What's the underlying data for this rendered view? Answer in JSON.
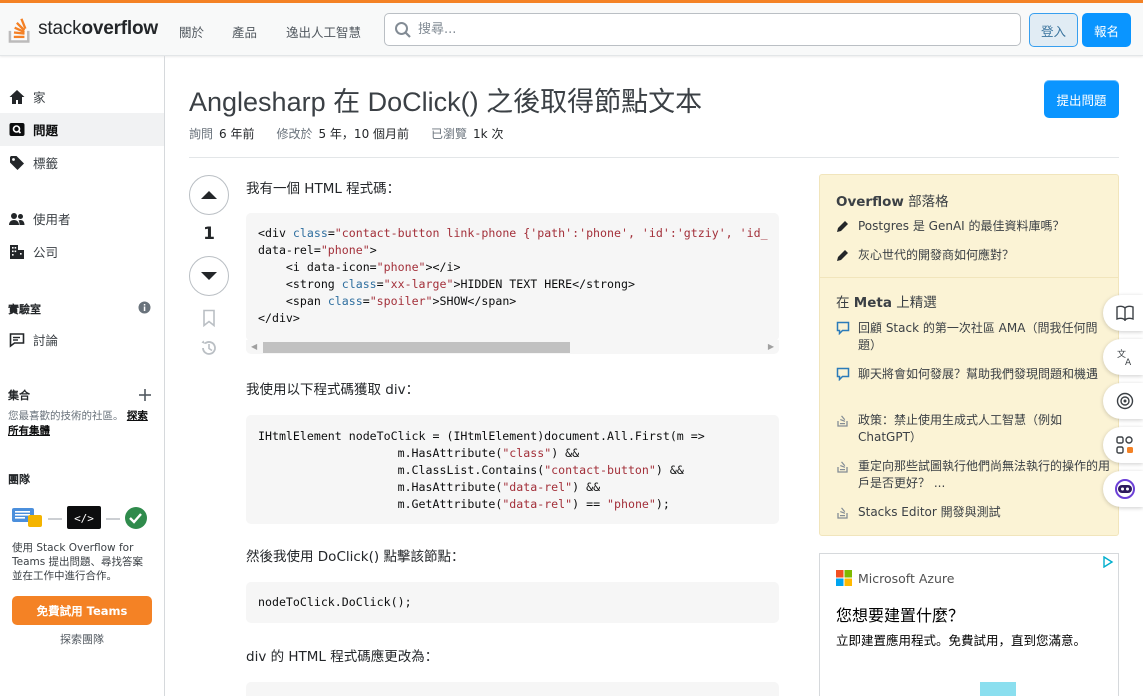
{
  "header": {
    "logo_prefix": "stack",
    "logo_suffix": "overflow",
    "nav": [
      "關於",
      "產品",
      "逸出人工智慧"
    ],
    "search_placeholder": "搜尋...",
    "login_label": "登入",
    "signup_label": "報名"
  },
  "sidebar": {
    "items": [
      {
        "label": "家",
        "icon": "home-icon"
      },
      {
        "label": "問題",
        "icon": "questions-icon",
        "active": true
      },
      {
        "label": "標籤",
        "icon": "tag-icon"
      },
      {
        "label": "使用者",
        "icon": "users-icon"
      },
      {
        "label": "公司",
        "icon": "building-icon"
      }
    ],
    "labs_heading": "實驗室",
    "labs_items": [
      {
        "label": "討論",
        "icon": "discussion-icon"
      }
    ],
    "collectives_heading": "集合",
    "collectives_text": "您最喜歡的技術的社區。",
    "collectives_link": "探索所有集體",
    "teams_heading": "團隊",
    "teams_text": "使用 Stack Overflow for Teams 提出問題、尋找答案並在工作中進行合作。",
    "teams_button": "免費試用 Teams",
    "teams_explore": "探索團隊"
  },
  "question": {
    "title": "Anglesharp 在 DoClick() 之後取得節點文本",
    "asked_label": "詢問",
    "asked_value": "6 年前",
    "modified_label": "修改於",
    "modified_value": "5 年，10 個月前",
    "viewed_label": "已瀏覽",
    "viewed_value": "1k 次",
    "ask_button": "提出問題",
    "vote_count": "1",
    "body": {
      "p1": "我有一個 HTML 程式碼：",
      "p2": "我使用以下程式碼獲取 div：",
      "p3": "然後我使用 DoClick() 點擊該節點：",
      "p4": "div 的 HTML 程式碼應更改為："
    }
  },
  "blog": {
    "heading_bold": "Overflow",
    "heading_rest": " 部落格",
    "items": [
      "Postgres 是 GenAI 的最佳資料庫嗎？",
      "灰心世代的開發商如何應對？"
    ],
    "meta_heading_prefix": "在 ",
    "meta_heading_bold": "Meta",
    "meta_heading_suffix": " 上精選",
    "meta_items": [
      {
        "text": "回顧 Stack 的第一次社區 AMA（問我任何問題）",
        "icon": "comment-icon"
      },
      {
        "text": "聊天將會如何發展？幫助我們發現問題和機遇",
        "icon": "comment-icon"
      },
      {
        "text": "政策：禁止使用生成式人工智慧（例如 ChatGPT）",
        "icon": "stack-icon"
      },
      {
        "text": "重定向那些試圖執行他們尚無法執行的操作的用戶是否更好？ ...",
        "icon": "stack-icon"
      },
      {
        "text": "Stacks Editor 開發與測試",
        "icon": "stack-icon"
      }
    ]
  },
  "ad": {
    "brand": "Microsoft Azure",
    "title": "您想要建置什麼？",
    "text": "立即建置應用程式。免費試用，直到您滿意。"
  },
  "colors": {
    "accent": "#f48225",
    "primary_button": "#0a95ff",
    "blog_bg": "#fbf3d5"
  }
}
